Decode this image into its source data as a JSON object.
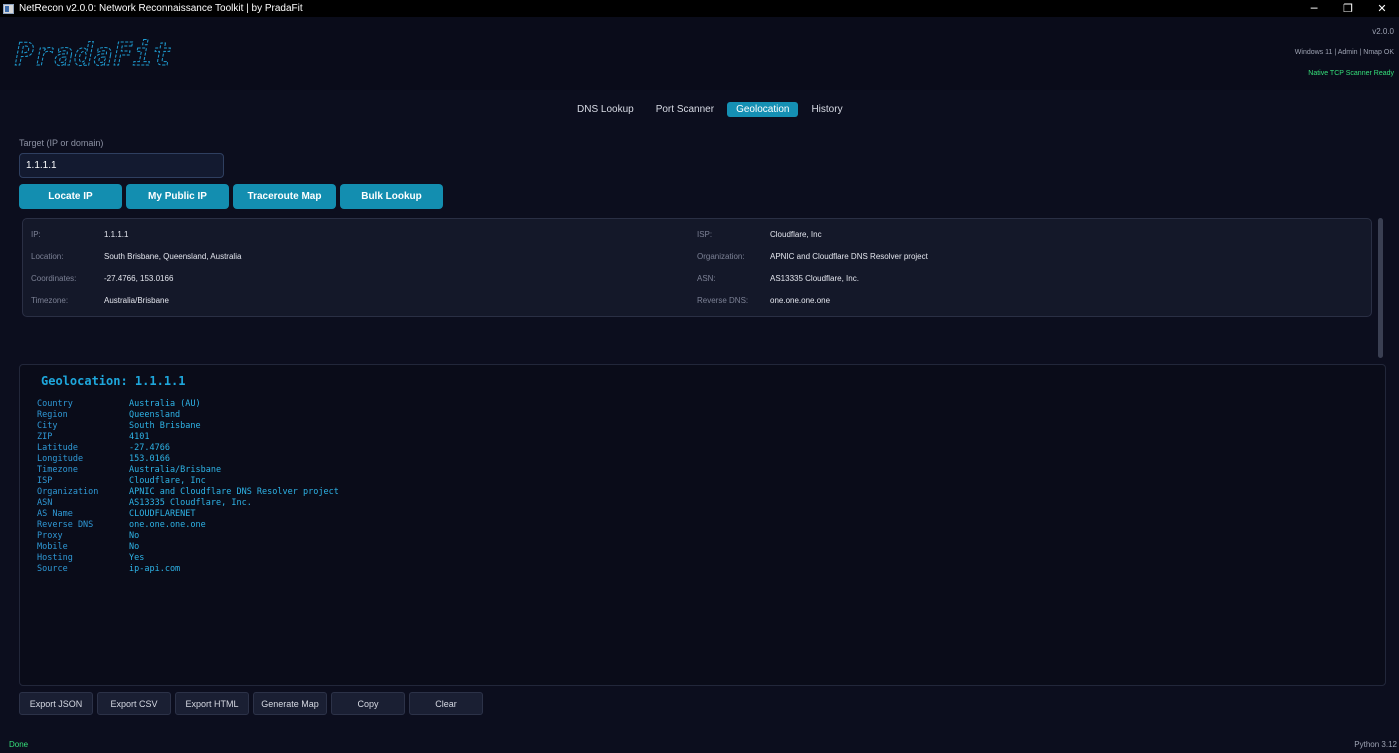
{
  "window": {
    "title": "NetRecon v2.0.0: Network Reconnaissance Toolkit  |  by PradaFit",
    "minimize": "─",
    "maximize": "❐",
    "close": "✕"
  },
  "header": {
    "logo_text": "PradaFit",
    "version": "v2.0.0",
    "system_info": "Windows 11 | Admin | Nmap OK",
    "scanner_status": "Native TCP Scanner Ready"
  },
  "tabs": [
    {
      "label": "DNS Lookup",
      "active": false
    },
    {
      "label": "Port Scanner",
      "active": false
    },
    {
      "label": "Geolocation",
      "active": true
    },
    {
      "label": "History",
      "active": false
    }
  ],
  "target": {
    "label": "Target (IP or domain)",
    "value": "1.1.1.1"
  },
  "actions": [
    "Locate IP",
    "My Public IP",
    "Traceroute Map",
    "Bulk Lookup"
  ],
  "info_card": {
    "left": [
      {
        "label": "IP:",
        "value": "1.1.1.1"
      },
      {
        "label": "Location:",
        "value": "South Brisbane, Queensland, Australia"
      },
      {
        "label": "Coordinates:",
        "value": "-27.4766, 153.0166"
      },
      {
        "label": "Timezone:",
        "value": "Australia/Brisbane"
      }
    ],
    "right": [
      {
        "label": "ISP:",
        "value": "Cloudflare, Inc"
      },
      {
        "label": "Organization:",
        "value": "APNIC and Cloudflare DNS Resolver project"
      },
      {
        "label": "ASN:",
        "value": "AS13335 Cloudflare, Inc."
      },
      {
        "label": "Reverse DNS:",
        "value": "one.one.one.one"
      }
    ]
  },
  "console": {
    "title": "Geolocation: 1.1.1.1",
    "rows": [
      {
        "key": "Country",
        "value": "Australia (AU)"
      },
      {
        "key": "Region",
        "value": "Queensland"
      },
      {
        "key": "City",
        "value": "South Brisbane"
      },
      {
        "key": "ZIP",
        "value": "4101"
      },
      {
        "key": "Latitude",
        "value": "-27.4766"
      },
      {
        "key": "Longitude",
        "value": "153.0166"
      },
      {
        "key": "Timezone",
        "value": "Australia/Brisbane"
      },
      {
        "key": "ISP",
        "value": "Cloudflare, Inc"
      },
      {
        "key": "Organization",
        "value": "APNIC and Cloudflare DNS Resolver project"
      },
      {
        "key": "ASN",
        "value": "AS13335 Cloudflare, Inc."
      },
      {
        "key": "AS Name",
        "value": "CLOUDFLARENET"
      },
      {
        "key": "Reverse DNS",
        "value": "one.one.one.one"
      },
      {
        "key": "Proxy",
        "value": "No"
      },
      {
        "key": "Mobile",
        "value": "No"
      },
      {
        "key": "Hosting",
        "value": "Yes"
      },
      {
        "key": "Source",
        "value": "ip-api.com"
      }
    ]
  },
  "exports": [
    "Export JSON",
    "Export CSV",
    "Export HTML",
    "Generate Map",
    "Copy",
    "Clear"
  ],
  "status": {
    "left": "Done",
    "right": "Python 3.12"
  },
  "colors": {
    "accent": "#1590b4",
    "success": "#35e07a",
    "console_text": "#2eb3e6",
    "background": "#0c0e1e"
  }
}
